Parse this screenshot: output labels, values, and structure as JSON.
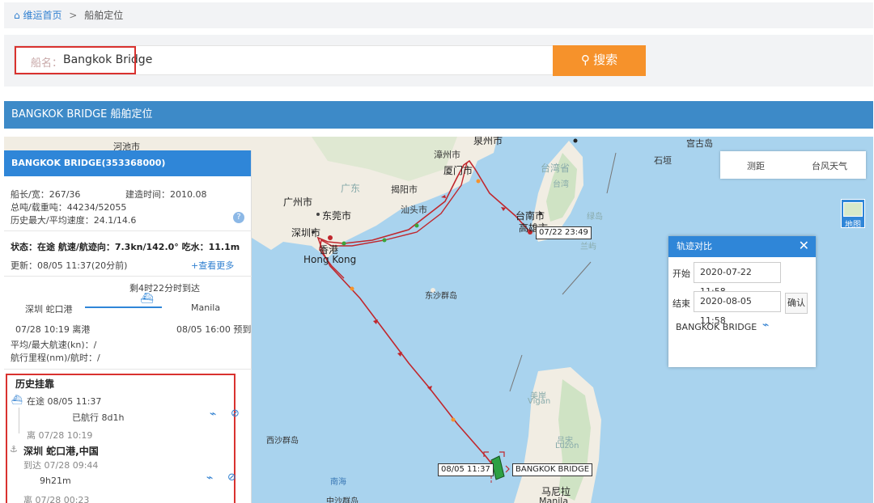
{
  "breadcrumb": {
    "home": "维运首页",
    "separator": ">",
    "current": "船舶定位"
  },
  "search": {
    "label": "船名：",
    "value": "Bangkok Bridge",
    "button": "搜索"
  },
  "page_title": "BANGKOK BRIDGE 船舶定位",
  "ship": {
    "header": "BANGKOK BRIDGE(353368000)",
    "dims": "船长/宽：267/36",
    "built": "建造时间：2010.08",
    "tonnage": "总吨/载重吨：44234/52055",
    "speed": "历史最大/平均速度：24.1/14.6",
    "status_line": "状态：在途 航速/航迹向：7.3kn/142.0° 吃水：11.1m",
    "updated": "更新：08/05 11:37(20分前)",
    "more_link": "+查看更多",
    "eta_remaining": "剩4时22分时到达",
    "origin": "深圳 蛇口港",
    "destination": "Manila",
    "depart": "07/28 10:19 离港",
    "eta": "08/05 16:00 预到",
    "avg_speed": "平均/最大航速(kn)：/",
    "distance": "航行里程(nm)/航时：/"
  },
  "history": {
    "title": "历史挂靠",
    "current_status": "在途 08/05 11:37",
    "sailed": "已航行 8d1h",
    "left_1": "离 07/28 10:19",
    "port": "深圳 蛇口港,中国",
    "arrived": "到达 07/28 09:44",
    "stay": "9h21m",
    "left_2": "离 07/28 00:23"
  },
  "map_tools": {
    "distance": "测距",
    "typhoon": "台风天气",
    "layer": "地图"
  },
  "track_panel": {
    "title": "轨迹对比",
    "start_label": "开始",
    "start_value": "2020-07-22 11:58",
    "end_label": "结束",
    "end_value": "2020-08-05 11:58",
    "confirm": "确认",
    "ship_name": "BANGKOK BRIDGE"
  },
  "map_labels": {
    "hechi": "河池市",
    "quanzhou": "泉州市",
    "zhangzhou": "漳州市",
    "xiamen": "厦门市",
    "guangdong": "广东",
    "jieyang": "揭阳市",
    "shantou": "汕头市",
    "guangzhou": "广州市",
    "dongguan": "东莞市",
    "shenzhen": "深圳市",
    "xianggang": "香港",
    "hongkong": "Hong Kong",
    "taiwan": "台湾省",
    "taiwan2": "台湾",
    "tainan": "台南市",
    "gaoxiong": "高雄市",
    "ludao": "绿岛",
    "lanyu": "兰屿",
    "shiyuan": "石垣",
    "gonggu": "宫古岛",
    "dongsha": "东沙群岛",
    "xisha": "西沙群岛",
    "nanhai": "南海",
    "zhongsha": "中沙群岛",
    "meigan": "美岸",
    "vigan": "Vigan",
    "lvsong": "吕宋",
    "luzon": "Luzon",
    "manila_cn": "马尼拉",
    "manila": "Manila"
  },
  "map_tags": {
    "time_start": "07/22 23:49",
    "time_now": "08/05 11:37",
    "ship_tag": "BANGKOK BRIDGE"
  },
  "colors": {
    "accent": "#2f86d8",
    "search_button": "#f6922b",
    "track": "#c0272d",
    "highlight": "#d9322f"
  }
}
